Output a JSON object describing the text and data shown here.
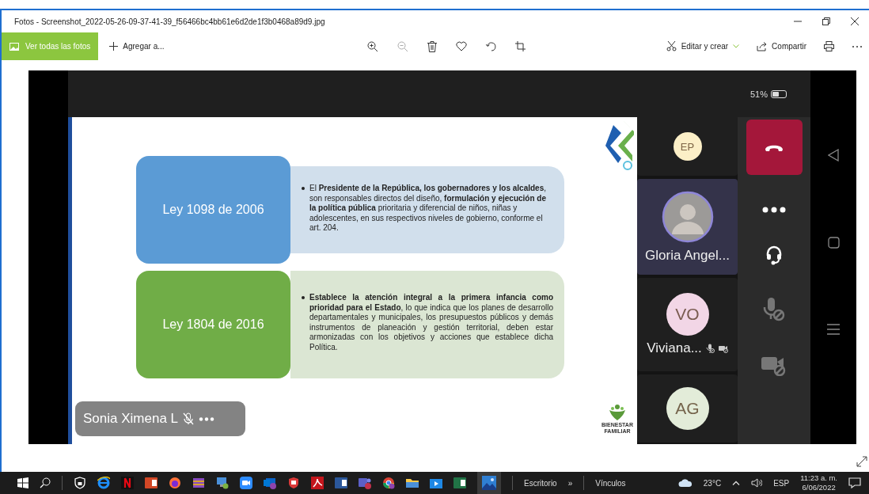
{
  "window": {
    "title": "Fotos - Screenshot_2022-05-26-09-37-41-39_f56466bc4bb61e6d2de1f3b0468a89d9.jpg"
  },
  "toolbar": {
    "view_all": "Ver todas las fotos",
    "add": "Agregar a...",
    "edit": "Editar y crear",
    "share": "Compartir"
  },
  "phone": {
    "battery": "51%",
    "slide": {
      "rows": [
        {
          "title": "Ley 1098 de 2006",
          "color": "#5b9bd5",
          "text": "El **Presidente de la República, los gobernadores y los alcaldes**, son responsables directos del diseño, **formulación y ejecución de la política pública** prioritaria y diferencial de niños, niñas y adolescentes, en sus respectivos niveles de gobierno, conforme el art. 204."
        },
        {
          "title": "Ley 1804 de 2016",
          "color": "#70ad47",
          "text": "**Establece la atención integral a la primera infancia como prioridad para el Estado**, lo que indica que los planes de desarrollo departamentales y municipales, los presupuestos públicos y demás instrumentos de planeación y gestión territorial, deben estar armonizadas con los objetivos y acciones que establece dicha Política."
        }
      ],
      "logo_text": "BIENESTAR FAMILIAR"
    },
    "presenter": {
      "name": "Sonia Ximena L",
      "muted": true
    },
    "participants": [
      {
        "kind": "initials",
        "initials": "EP",
        "color": "#fcefc7",
        "selected": false
      },
      {
        "kind": "photo",
        "name": "Gloria Angel...",
        "selected": true,
        "muted": false
      },
      {
        "kind": "initials",
        "initials": "VO",
        "name": "Viviana...",
        "color": "#f2d6e6",
        "selected": false,
        "muted": true
      },
      {
        "kind": "initials",
        "initials": "AG",
        "color": "#e3ecd9",
        "selected": false
      }
    ]
  },
  "taskbar": {
    "desktop": "Escritorio",
    "more": "»",
    "links": "Vínculos",
    "weather": "23°C",
    "language": "ESP",
    "time": "11:23 a. m.",
    "date": "6/06/2022"
  }
}
